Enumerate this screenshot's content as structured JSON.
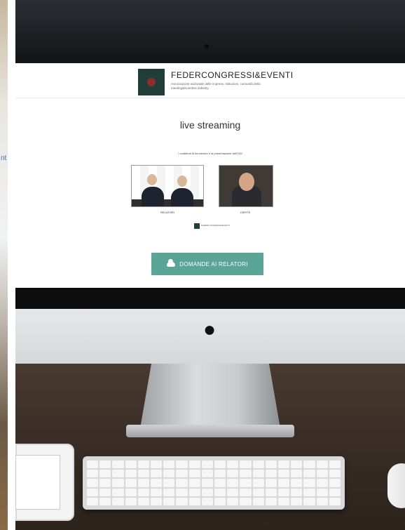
{
  "page": {
    "header": {
      "logo_title": "FEDERCONGRESSI&EVENTI",
      "logo_subtitle": "Associazione nazionale delle imprese, istituzioni, comunità della meeting&incentive industry"
    },
    "live": {
      "title": "live streaming",
      "intro": "I contributi di benvenuto e la presentazione dell'ODI"
    },
    "videos": [
      {
        "label": "RELATORI"
      },
      {
        "label": "OSPITE"
      }
    ],
    "small_logo_text": "FEDERCONGRESSI&EVENTI",
    "cta": {
      "label": "DOMANDE AI RELATORI"
    },
    "left_edge_text": "nt"
  },
  "colors": {
    "accent": "#5aa597",
    "logo_green": "#213d37",
    "logo_red": "#8d2d2d"
  }
}
